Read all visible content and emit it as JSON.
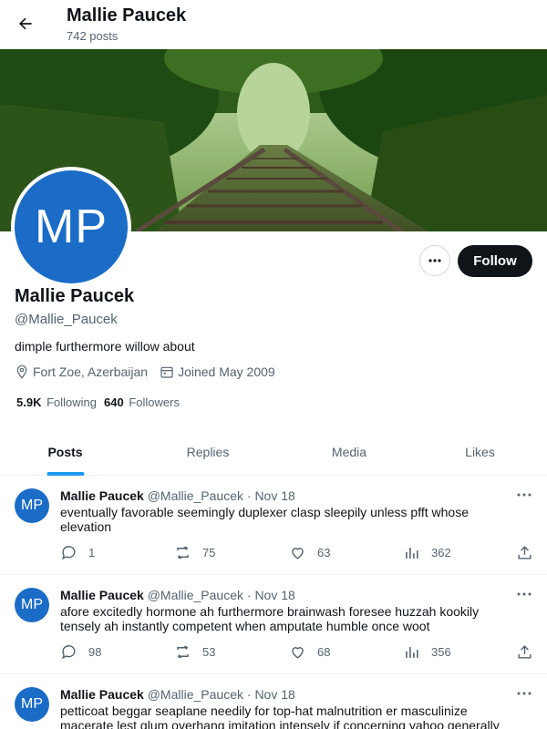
{
  "header": {
    "name": "Mallie Paucek",
    "post_count": "742 posts"
  },
  "profile": {
    "initials": "MP",
    "name": "Mallie Paucek",
    "handle": "@Mallie_Paucek",
    "bio": "dimple furthermore willow about",
    "location": "Fort Zoe, Azerbaijan",
    "joined": "Joined May 2009",
    "following_count": "5.9K",
    "following_label": "Following",
    "followers_count": "640",
    "followers_label": "Followers",
    "follow_label": "Follow"
  },
  "tabs": [
    {
      "label": "Posts",
      "active": true
    },
    {
      "label": "Replies",
      "active": false
    },
    {
      "label": "Media",
      "active": false
    },
    {
      "label": "Likes",
      "active": false
    }
  ],
  "tweets": [
    {
      "author": "Mallie Paucek",
      "handle": "@Mallie_Paucek",
      "dot": "·",
      "date": "Nov 18",
      "text": "eventually favorable seemingly duplexer clasp sleepily unless pfft whose elevation",
      "replies": "1",
      "reposts": "75",
      "likes": "63",
      "views": "362"
    },
    {
      "author": "Mallie Paucek",
      "handle": "@Mallie_Paucek",
      "dot": "·",
      "date": "Nov 18",
      "text": "afore excitedly hormone ah furthermore brainwash foresee huzzah kookily tensely ah instantly competent when amputate humble once woot",
      "replies": "98",
      "reposts": "53",
      "likes": "68",
      "views": "356"
    },
    {
      "author": "Mallie Paucek",
      "handle": "@Mallie_Paucek",
      "dot": "·",
      "date": "Nov 18",
      "text": "petticoat beggar seaplane needily for top-hat malnutrition er masculinize macerate lest glum overhang imitation intensely if concerning yahoo generally",
      "replies": "",
      "reposts": "",
      "likes": "",
      "views": ""
    }
  ],
  "colors": {
    "accent": "#1d9bf0",
    "avatar": "#1a6cc7",
    "follow_button": "#0f1419",
    "muted_text": "#536471"
  },
  "icons": [
    "back-arrow-icon",
    "more-icon",
    "location-icon",
    "calendar-icon",
    "reply-icon",
    "repost-icon",
    "like-icon",
    "views-icon",
    "share-icon"
  ]
}
